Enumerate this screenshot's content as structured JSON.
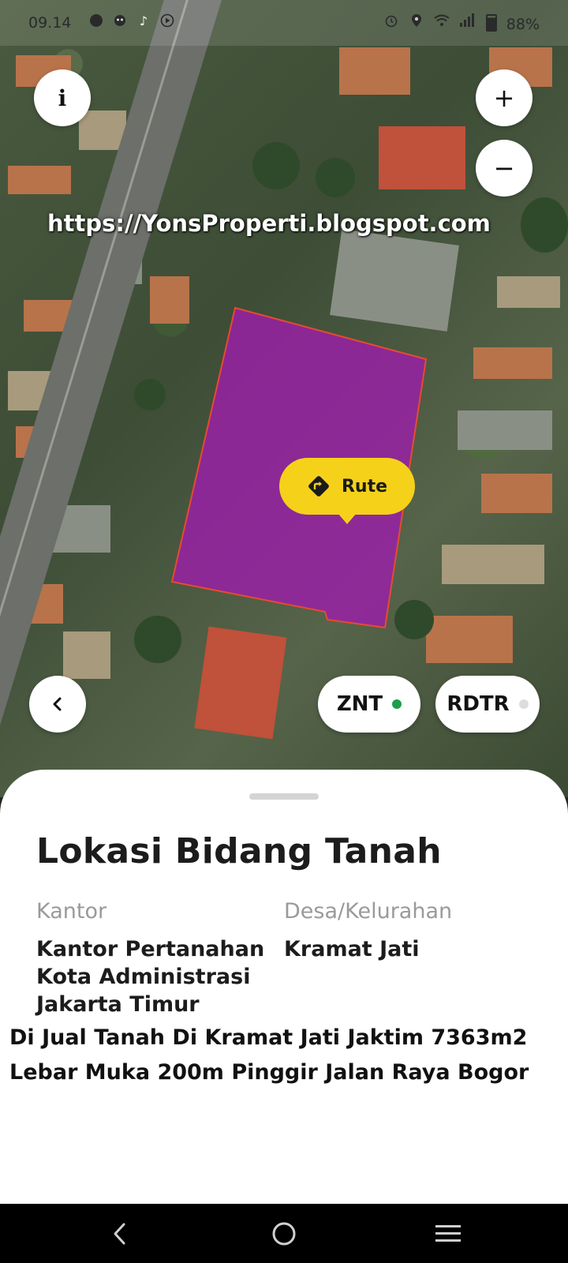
{
  "status_bar": {
    "time": "09.14",
    "left_icons": [
      "whatsapp-icon",
      "app-icon",
      "tiktok-icon",
      "play-icon"
    ],
    "right_icons": [
      "alarm-icon",
      "location-icon",
      "wifi-icon",
      "signal-icon"
    ],
    "battery": "88%"
  },
  "map": {
    "watermark": "https://YonsProperti.blogspot.com",
    "route_label": "Rute",
    "parcel_color": "#9b1fa8",
    "route_color": "#f6d11a"
  },
  "controls": {
    "info_label": "i",
    "zoom_in_label": "+",
    "zoom_out_label": "−",
    "znt_label": "ZNT",
    "znt_status_color": "#1e9e4a",
    "rdtr_label": "RDTR",
    "rdtr_status_color": "#dddddd"
  },
  "sheet": {
    "title": "Lokasi Bidang Tanah",
    "kantor_label": "Kantor",
    "kantor_value": [
      "Kantor Pertanahan",
      "Kota Administrasi",
      "Jakarta Timur"
    ],
    "desa_label": "Desa/Kelurahan",
    "desa_value": "Kramat Jati",
    "caption_line1": "Di Jual Tanah Di Kramat Jati Jaktim 7363m2",
    "caption_line2": "Lebar Muka 200m Pinggir Jalan Raya Bogor"
  },
  "nav": {
    "icons": [
      "back-nav-icon",
      "home-nav-icon",
      "recents-nav-icon"
    ]
  }
}
